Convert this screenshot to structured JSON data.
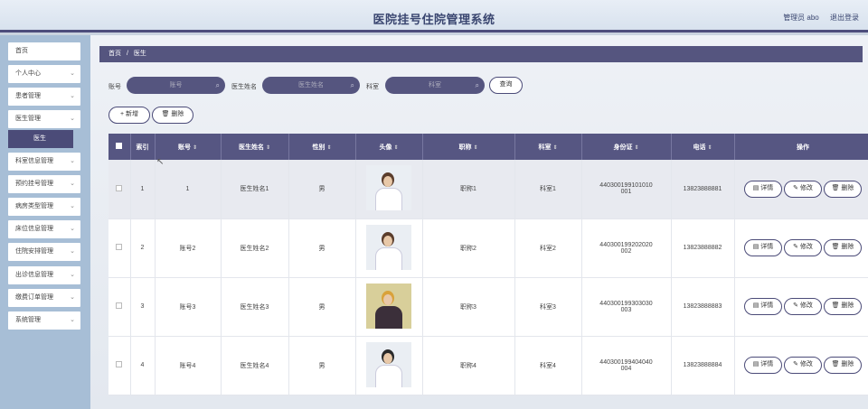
{
  "header": {
    "title": "医院挂号住院管理系统",
    "user": "管理员 abo",
    "logout": "退出登录"
  },
  "sidebar": {
    "items": [
      {
        "label": "首页",
        "chev": ""
      },
      {
        "label": "个人中心",
        "chev": "⌄"
      },
      {
        "label": "患者管理",
        "chev": "⌄"
      },
      {
        "label": "医生管理",
        "chev": "⌄"
      },
      {
        "label": "科室信息管理",
        "chev": "⌄"
      },
      {
        "label": "预约挂号管理",
        "chev": "⌄"
      },
      {
        "label": "病房类型管理",
        "chev": "⌄"
      },
      {
        "label": "床位信息管理",
        "chev": "⌄"
      },
      {
        "label": "住院安排管理",
        "chev": "⌄"
      },
      {
        "label": "出诊信息管理",
        "chev": "⌄"
      },
      {
        "label": "缴费订单管理",
        "chev": "⌄"
      },
      {
        "label": "系统管理",
        "chev": "⌄"
      }
    ],
    "sub_item": "医生"
  },
  "breadcrumb": {
    "home": "首页",
    "sep": "/",
    "current": "医生"
  },
  "search": {
    "account_label": "账号",
    "account_placeholder": "账号",
    "name_label": "医生姓名",
    "name_placeholder": "医生姓名",
    "dept_label": "科室",
    "dept_placeholder": "科室",
    "query": "查询"
  },
  "actions": {
    "add": "+ 新增",
    "delete": "🗑 删除"
  },
  "table": {
    "headers": [
      "索引",
      "账号",
      "医生姓名",
      "性别",
      "头像",
      "职称",
      "科室",
      "身份证",
      "电话",
      "操作"
    ],
    "rows": [
      {
        "index": "1",
        "account": "1",
        "name": "医生姓名1",
        "gender": "男",
        "title": "职称1",
        "dept": "科室1",
        "id_l1": "440300199101010",
        "id_l2": "001",
        "phone": "13823888881"
      },
      {
        "index": "2",
        "account": "账号2",
        "name": "医生姓名2",
        "gender": "男",
        "title": "职称2",
        "dept": "科室2",
        "id_l1": "440300199202020",
        "id_l2": "002",
        "phone": "13823888882"
      },
      {
        "index": "3",
        "account": "账号3",
        "name": "医生姓名3",
        "gender": "男",
        "title": "职称3",
        "dept": "科室3",
        "id_l1": "440300199303030",
        "id_l2": "003",
        "phone": "13823888883"
      },
      {
        "index": "4",
        "account": "账号4",
        "name": "医生姓名4",
        "gender": "男",
        "title": "职称4",
        "dept": "科室4",
        "id_l1": "440300199404040",
        "id_l2": "004",
        "phone": "13823888884"
      }
    ],
    "op_detail": "详情",
    "op_edit": "修改",
    "op_delete": "删除"
  },
  "icons": {
    "search": "search-icon",
    "detail": "document-icon",
    "edit": "pencil-icon",
    "trash": "trash-icon",
    "sort": "sort-icon"
  },
  "colors": {
    "primary": "#55557f",
    "sidebar_bg": "#a7bed6",
    "active": "#4b4b78"
  }
}
